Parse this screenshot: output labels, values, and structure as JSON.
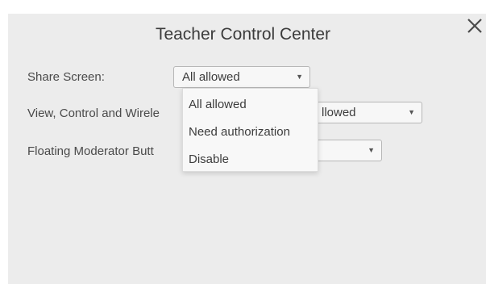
{
  "dialog": {
    "title": "Teacher Control Center",
    "close_icon": "close-icon"
  },
  "settings": [
    {
      "label": "Share Screen:",
      "value": "All allowed"
    },
    {
      "label": "View, Control and Wirele",
      "value": "llowed"
    },
    {
      "label": "Floating Moderator Butt",
      "value": ""
    }
  ],
  "dropdown": {
    "options": [
      "All allowed",
      "Need authorization",
      "Disable"
    ]
  },
  "icons": {
    "caret": "caret-down-icon"
  }
}
